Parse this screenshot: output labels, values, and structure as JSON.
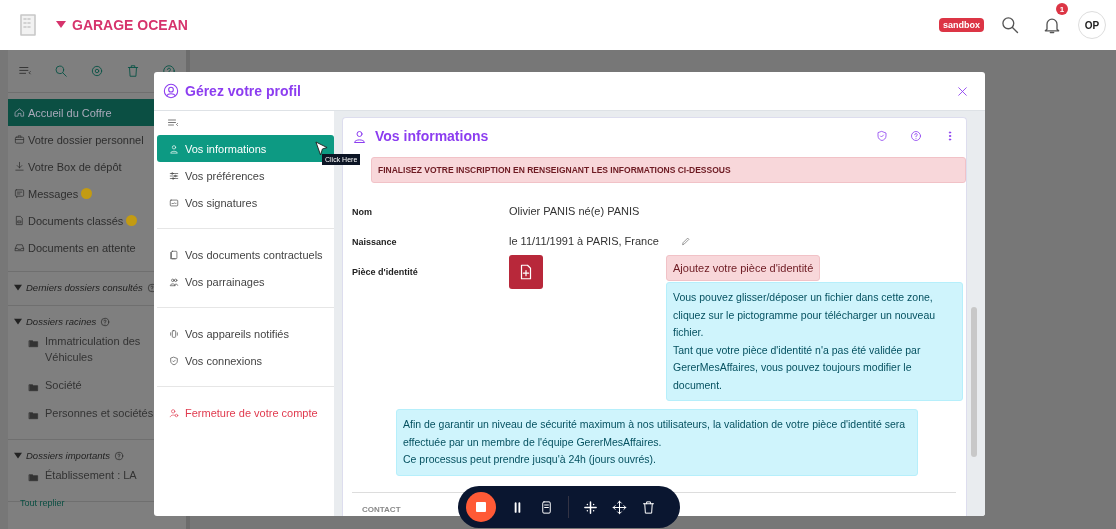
{
  "header": {
    "brand": "GARAGE OCEAN",
    "env_badge": "sandbox",
    "notification_count": "1",
    "avatar": "OP"
  },
  "sidebar": {
    "items": [
      {
        "label": "Accueil du Coffre",
        "selected": true,
        "notified": false
      },
      {
        "label": "Votre dossier personnel",
        "selected": false,
        "notified": false
      },
      {
        "label": "Votre Box de dépôt",
        "selected": false,
        "notified": false
      },
      {
        "label": "Messages",
        "selected": false,
        "notified": true
      },
      {
        "label": "Documents classés",
        "selected": false,
        "notified": true
      },
      {
        "label": "Documents en attente",
        "selected": false,
        "notified": false
      }
    ],
    "sections": [
      {
        "title": "Derniers dossiers consultés",
        "expanded": true
      },
      {
        "title": "Dossiers racines",
        "expanded": true,
        "items": [
          "Immatriculation des Véhicules",
          "Société",
          "Personnes et sociétés"
        ]
      },
      {
        "title": "Dossiers importants",
        "expanded": true,
        "items": [
          "Établissement : LA"
        ]
      }
    ],
    "footer": "Tout replier"
  },
  "modal": {
    "title": "Gérez votre profil",
    "nav": [
      [
        {
          "label": "Vos informations",
          "kind": "normal",
          "selected": true
        },
        {
          "label": "Vos préférences",
          "kind": "normal",
          "selected": false
        },
        {
          "label": "Vos signatures",
          "kind": "normal",
          "selected": false
        }
      ],
      [
        {
          "label": "Vos documents contractuels",
          "kind": "normal",
          "selected": false
        },
        {
          "label": "Vos parrainages",
          "kind": "normal",
          "selected": false
        }
      ],
      [
        {
          "label": "Vos appareils notifiés",
          "kind": "normal",
          "selected": false
        },
        {
          "label": "Vos connexions",
          "kind": "normal",
          "selected": false
        }
      ],
      [
        {
          "label": "Fermeture de votre compte",
          "kind": "danger",
          "selected": false
        }
      ]
    ],
    "tooltip": "Click Here",
    "panel": {
      "title": "Vos informations",
      "alert": "FINALISEZ VOTRE INSCRIPTION EN RENSEIGNANT LES INFORMATIONS CI-DESSOUS",
      "fields": [
        {
          "label": "Nom",
          "value": "Olivier PANIS né(e) PANIS",
          "editable": false
        },
        {
          "label": "Naissance",
          "value": "le 11/11/1991 à PARIS, France",
          "editable": true
        }
      ],
      "id_document": {
        "label": "Pièce d'identité",
        "prompt": "Ajoutez votre pièce d'identité",
        "help": [
          "Vous pouvez glisser/déposer un fichier dans cette zone, cliquez sur le pictogramme pour télécharger un nouveau fichier.",
          "Tant que votre pièce d'identité n'a pas été validée par GererMesAffaires, vous pouvez toujours modifier le document."
        ],
        "note": [
          "Afin de garantir un niveau de sécurité maximum à nos utilisateurs, la validation de votre pièce d'identité sera effectuée par un membre de l'équipe GererMesAffaires.",
          "Ce processus peut prendre jusqu'à 24h (jours ouvrés)."
        ]
      },
      "next_section": "CONTACT"
    }
  }
}
